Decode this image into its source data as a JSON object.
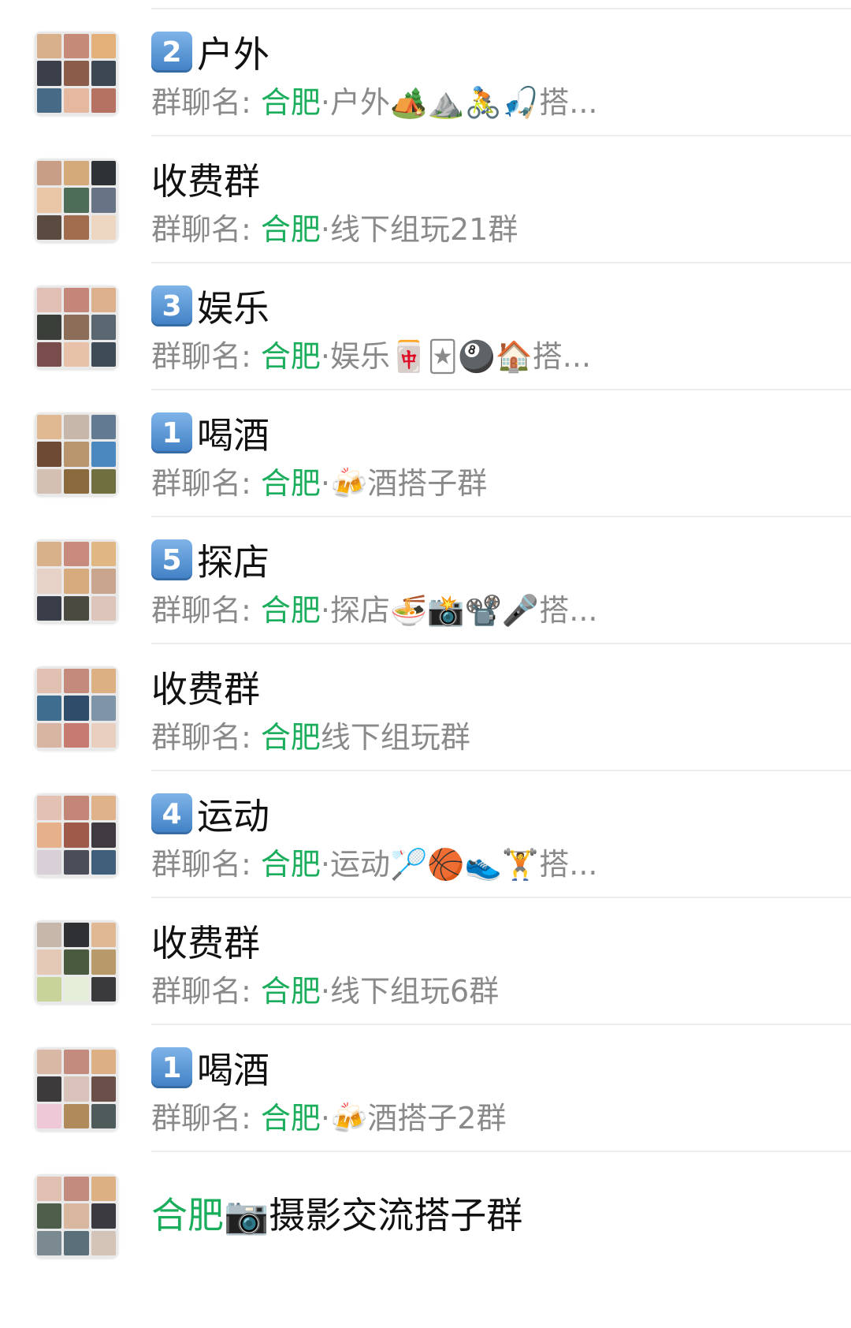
{
  "groups": [
    {
      "badge": "2",
      "name": "户外",
      "label": "群聊名: ",
      "city": "合肥",
      "rest": "·户外🏕️⛰️🚴🎣搭...",
      "avatar_colors": [
        "#d9b08c",
        "#c68b78",
        "#e3b07a",
        "#3b3f4a",
        "#8a5c49",
        "#3d4752",
        "#476a86",
        "#e7b8a0",
        "#b57262"
      ]
    },
    {
      "badge": "",
      "name": "收费群",
      "label": "群聊名: ",
      "city": "合肥",
      "rest": "·线下组玩21群",
      "avatar_colors": [
        "#c89e86",
        "#d5aa7a",
        "#2e3135",
        "#e9c6a6",
        "#4e6d59",
        "#697386",
        "#5a4a40",
        "#a16b4d",
        "#eed7c2"
      ]
    },
    {
      "badge": "3",
      "name": "娱乐",
      "label": "群聊名: ",
      "city": "合肥",
      "rest": "·娱乐🀄🃏🎱🏠搭...",
      "avatar_colors": [
        "#e2bfb5",
        "#c48678",
        "#dcb08d",
        "#3a3e38",
        "#8c6d58",
        "#5a6670",
        "#7a4d4d",
        "#e8c2a8",
        "#3f4b57"
      ]
    },
    {
      "badge": "1",
      "name": "喝酒",
      "label": "群聊名: ",
      "city": "合肥",
      "rest": "·🍻酒搭子群",
      "avatar_colors": [
        "#e0b892",
        "#c7b7aa",
        "#627a92",
        "#6e4a34",
        "#b8956c",
        "#4b88bf",
        "#d3c0b3",
        "#8a6a3c",
        "#6f6f3f"
      ]
    },
    {
      "badge": "5",
      "name": "探店",
      "label": "群聊名: ",
      "city": "合肥",
      "rest": "·探店🍜📸📽️🎤搭...",
      "avatar_colors": [
        "#d8b08a",
        "#c98a7e",
        "#e0b782",
        "#e6d2c6",
        "#d8ab7f",
        "#caa58e",
        "#3a3e48",
        "#4a4a40",
        "#ddc5bb"
      ]
    },
    {
      "badge": "",
      "name": "收费群",
      "label": "群聊名: ",
      "city": "合肥",
      "rest": "线下组玩群",
      "avatar_colors": [
        "#e0c0b0",
        "#c48a7c",
        "#dcb083",
        "#3f6d8f",
        "#2f4c6a",
        "#7f94a8",
        "#d8b4a2",
        "#c67a70",
        "#e9cfbf"
      ]
    },
    {
      "badge": "4",
      "name": "运动",
      "label": "群聊名: ",
      "city": "合肥",
      "rest": "·运动🏸🏀👟🏋️搭...",
      "avatar_colors": [
        "#e3c1b3",
        "#c38576",
        "#dfb28a",
        "#e6b08a",
        "#a05a4a",
        "#3e3a40",
        "#d8d0d6",
        "#4b4e58",
        "#3f5f7a"
      ]
    },
    {
      "badge": "",
      "name": "收费群",
      "label": "群聊名: ",
      "city": "合肥",
      "rest": "·线下组玩6群",
      "avatar_colors": [
        "#c7b7aa",
        "#2f3033",
        "#e0b893",
        "#e3c9b6",
        "#4a5a3f",
        "#b89a6a",
        "#c8d39a",
        "#e4eed8",
        "#3a3a3c"
      ]
    },
    {
      "badge": "1",
      "name": "喝酒",
      "label": "群聊名: ",
      "city": "合肥",
      "rest": "·🍻酒搭子2群",
      "avatar_colors": [
        "#d9b9a6",
        "#c28b7d",
        "#dcb084",
        "#3d3a3b",
        "#d8c2ba",
        "#6a5048",
        "#efc8d8",
        "#b08a5a",
        "#4f5a5a"
      ]
    },
    {
      "badge": "",
      "name": "",
      "label": "",
      "city": "合肥",
      "rest": "📷摄影交流搭子群",
      "avatar_colors": [
        "#e0c0b0",
        "#c38b7e",
        "#dcb083",
        "#4f5e4a",
        "#d8b79e",
        "#3a3a40",
        "#7a8a90",
        "#5b6f7a",
        "#d4c4b8"
      ]
    }
  ]
}
